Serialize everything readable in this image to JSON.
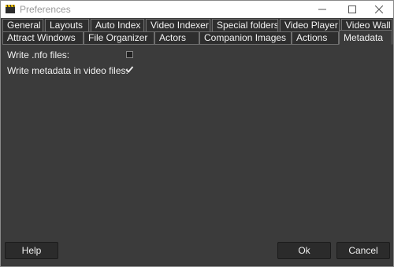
{
  "window": {
    "title": "Preferences"
  },
  "tabs_row1": [
    {
      "label": "General"
    },
    {
      "label": "Layouts"
    },
    {
      "label": "Auto Index"
    },
    {
      "label": "Video Indexer"
    },
    {
      "label": "Special folders"
    },
    {
      "label": "Video Player"
    },
    {
      "label": "Video Wall"
    }
  ],
  "tabs_row2": [
    {
      "label": "Attract Windows"
    },
    {
      "label": "File Organizer"
    },
    {
      "label": "Actors"
    },
    {
      "label": "Companion Images"
    },
    {
      "label": "Actions"
    },
    {
      "label": "Metadata",
      "active": true
    }
  ],
  "options": [
    {
      "label": "Write .nfo files:",
      "checked": false
    },
    {
      "label": "Write metadata in video files:",
      "checked": true
    }
  ],
  "buttons": {
    "help": "Help",
    "ok": "Ok",
    "cancel": "Cancel"
  },
  "colors": {
    "background": "#3b3b3b",
    "tab": "#2e2e2e",
    "text": "#f2f2f2"
  }
}
